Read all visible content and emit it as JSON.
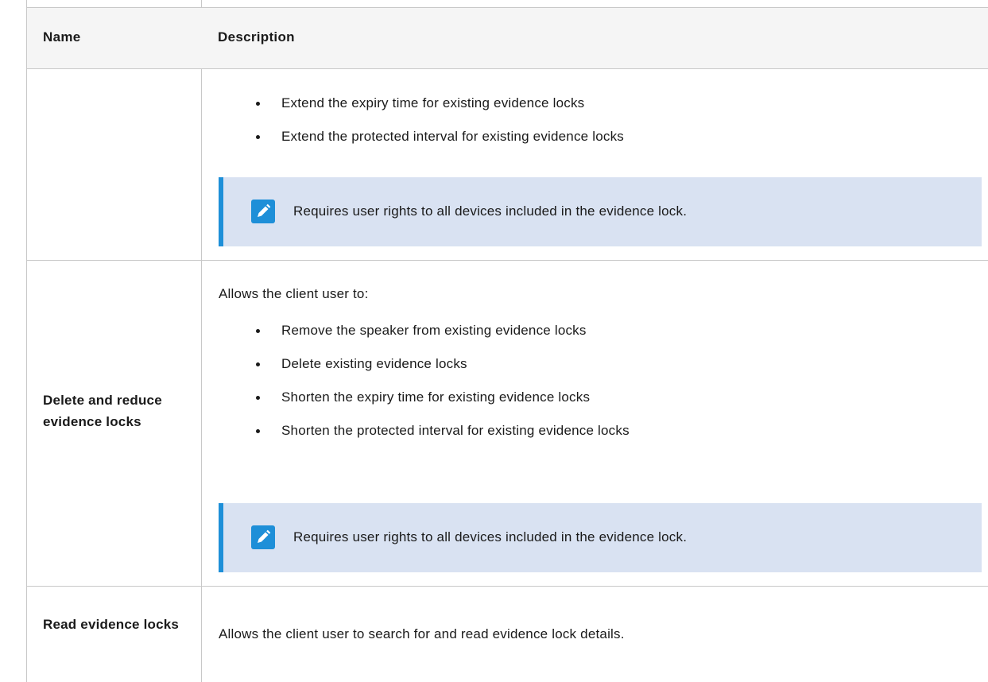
{
  "table": {
    "headers": {
      "name": "Name",
      "description": "Description"
    },
    "rows": [
      {
        "name": "",
        "bullets": [
          "Extend the expiry time for existing evidence locks",
          "Extend the protected interval for existing evidence locks"
        ],
        "note": {
          "icon": "pencil-icon",
          "text": "Requires user rights to all devices included in the evidence lock."
        }
      },
      {
        "name": "Delete and reduce evidence locks",
        "intro": "Allows the client user to:",
        "bullets": [
          "Remove the speaker from existing evidence locks",
          "Delete existing evidence locks",
          "Shorten the expiry time for existing evidence locks",
          "Shorten the protected interval for existing evidence locks"
        ],
        "note": {
          "icon": "pencil-icon",
          "text": "Requires user rights to all devices included in the evidence lock."
        }
      },
      {
        "name": "Read evidence locks",
        "description": "Allows the client user to search for and read evidence lock details."
      }
    ]
  },
  "colors": {
    "header_bg": "#f5f5f5",
    "note_bg": "#d9e2f2",
    "note_accent": "#1e8fd8",
    "border": "#c8c8c8",
    "text": "#1a1a1a"
  }
}
